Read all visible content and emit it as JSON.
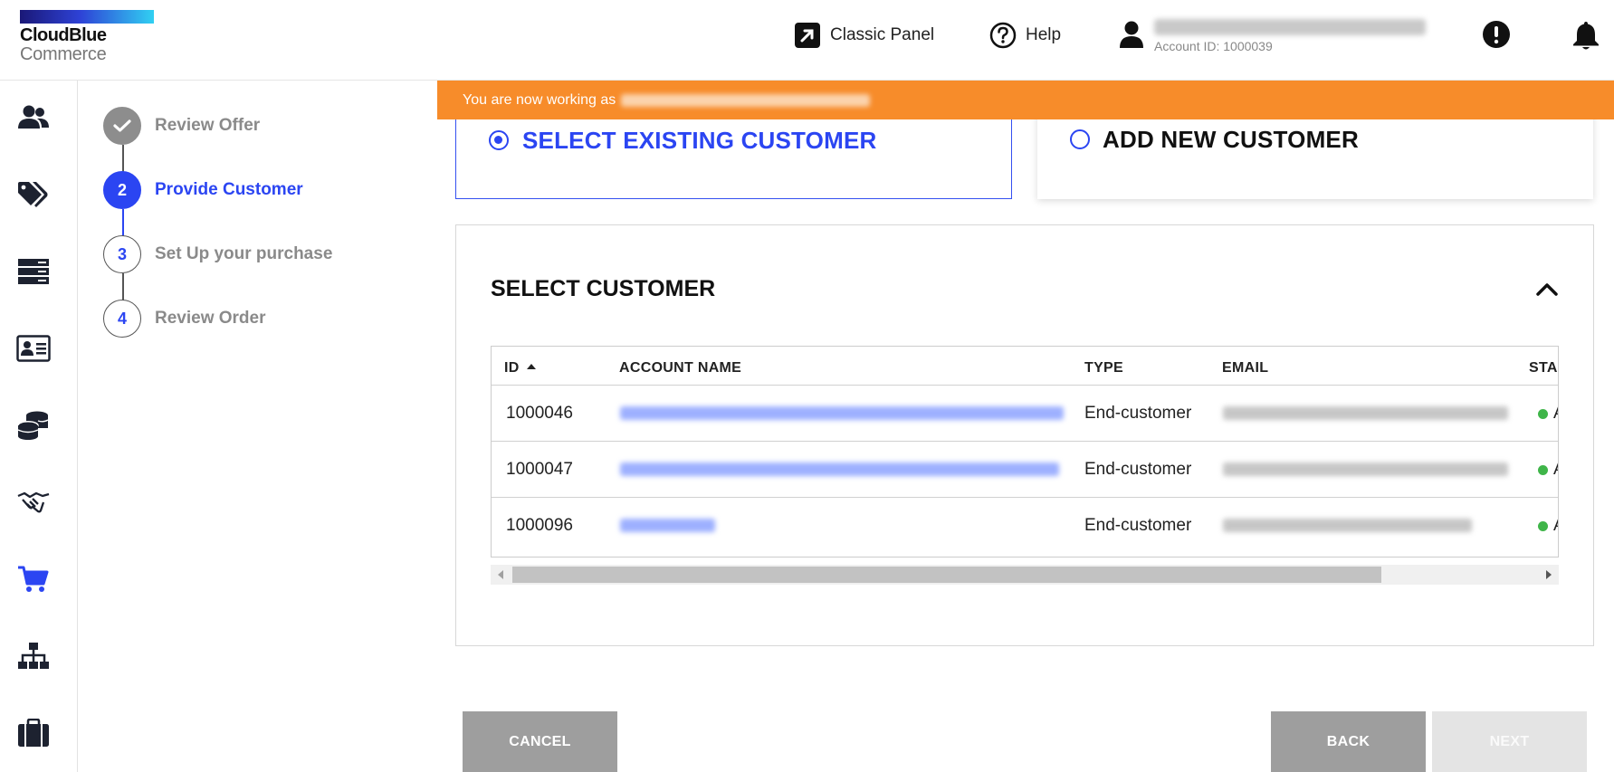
{
  "header": {
    "logo_line1": "CloudBlue",
    "logo_line2": "Commerce",
    "classic_panel": "Classic Panel",
    "help": "Help",
    "account_id": "Account ID: 1000039"
  },
  "banner": {
    "text": "You are now working as"
  },
  "sidebar": {
    "icons": [
      "users-icon",
      "tags-icon",
      "servers-icon",
      "contact-card-icon",
      "coins-icon",
      "handshake-icon",
      "cart-icon",
      "org-chart-icon",
      "briefcase-icon"
    ]
  },
  "steps": [
    {
      "num": "",
      "label": "Review Offer"
    },
    {
      "num": "2",
      "label": "Provide Customer"
    },
    {
      "num": "3",
      "label": "Set Up your purchase"
    },
    {
      "num": "4",
      "label": "Review Order"
    }
  ],
  "options": {
    "existing": "SELECT EXISTING CUSTOMER",
    "new": "ADD NEW CUSTOMER"
  },
  "customer_panel": {
    "title": "SELECT CUSTOMER",
    "columns": [
      "ID",
      "ACCOUNT NAME",
      "TYPE",
      "EMAIL",
      "STA"
    ],
    "rows": [
      {
        "id": "1000046",
        "type": "End-customer",
        "status": "A"
      },
      {
        "id": "1000047",
        "type": "End-customer",
        "status": "A"
      },
      {
        "id": "1000096",
        "type": "End-customer",
        "status": "A"
      }
    ]
  },
  "buttons": {
    "cancel": "CANCEL",
    "back": "BACK",
    "next": "NEXT"
  },
  "colors": {
    "accent_blue": "#2b45f2",
    "banner_orange": "#f78c2a",
    "status_green": "#3fb549",
    "button_gray": "#9e9e9e"
  }
}
